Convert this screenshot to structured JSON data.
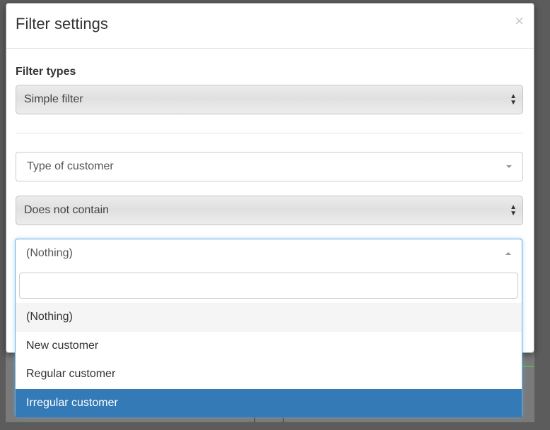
{
  "modal": {
    "title": "Filter settings",
    "close_label": "×"
  },
  "filter_types": {
    "label": "Filter types",
    "value": "Simple filter"
  },
  "field_select": {
    "value": "Type of customer"
  },
  "operator_select": {
    "value": "Does not contain"
  },
  "value_dropdown": {
    "value": "(Nothing)",
    "search_value": "",
    "options": [
      {
        "label": "(Nothing)",
        "state": "hover"
      },
      {
        "label": "New customer",
        "state": "normal"
      },
      {
        "label": "Regular customer",
        "state": "normal"
      },
      {
        "label": "Irregular customer",
        "state": "selected"
      }
    ]
  },
  "colors": {
    "accent": "#337ab7",
    "focus_border": "#66afe9"
  }
}
